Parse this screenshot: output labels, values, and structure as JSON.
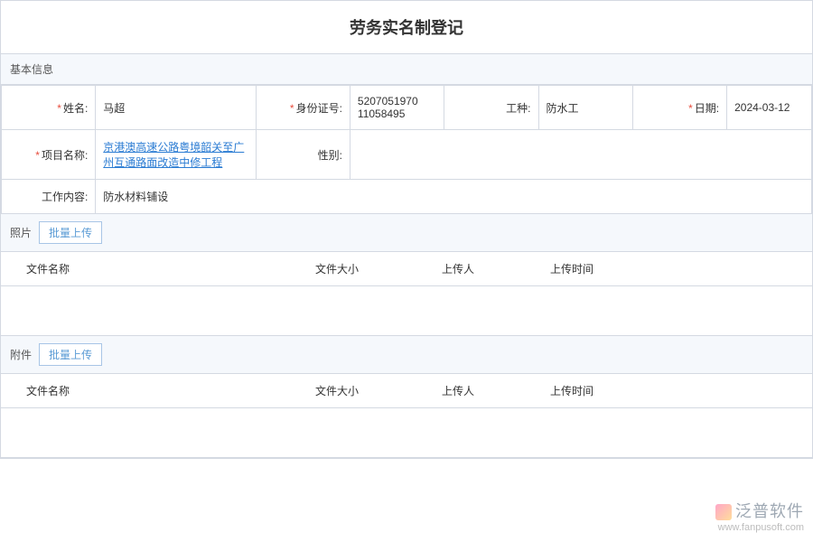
{
  "page": {
    "title": "劳务实名制登记"
  },
  "sections": {
    "basic_info": "基本信息",
    "photo": "照片",
    "attachment": "附件"
  },
  "buttons": {
    "batch_upload": "批量上传"
  },
  "form": {
    "name_label": "姓名:",
    "name_value": "马超",
    "id_label": "身份证号:",
    "id_value": "5207051970\n11058495",
    "worktype_label": "工种:",
    "worktype_value": "防水工",
    "date_label": "日期:",
    "date_value": "2024-03-12",
    "project_label": "项目名称:",
    "project_value": "京港澳高速公路粤境韶关至广州互通路面改造中修工程",
    "gender_label": "性别:",
    "gender_value": "",
    "content_label": "工作内容:",
    "content_value": "防水材料铺设"
  },
  "columns": {
    "filename": "文件名称",
    "filesize": "文件大小",
    "uploader": "上传人",
    "uploadtime": "上传时间"
  },
  "watermark": {
    "name": "泛普软件",
    "url": "www.fanpusoft.com"
  }
}
